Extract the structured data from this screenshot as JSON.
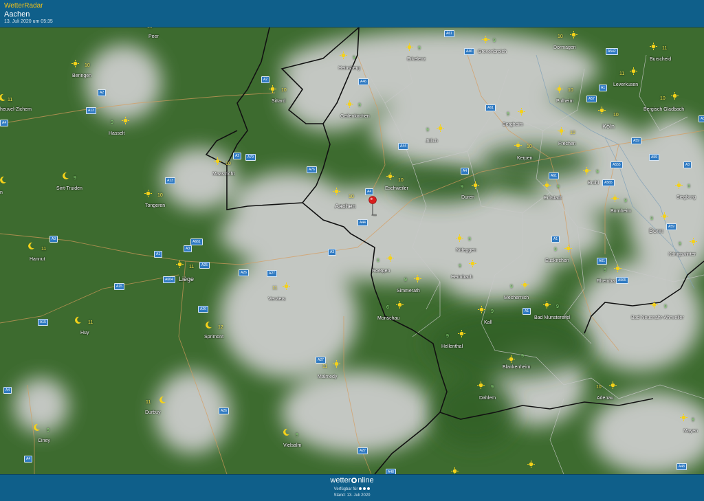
{
  "header": {
    "brand": "WetterRadar",
    "location": "Aachen",
    "timestamp": "13. Juli 2020 um 05:35"
  },
  "footer": {
    "logo_left": "wetter",
    "logo_right": "nline",
    "available": "Verfügbar für",
    "stand": "Stand: 13. Juli 2020"
  },
  "places": {
    "aachen": "Aachen",
    "eschweiler": "Eschweiler",
    "dueren": "Duren",
    "koeln": "Köln",
    "bonn": "Bonn",
    "liege": "Liège",
    "maastricht": "Maastricht",
    "sittard": "Sittard",
    "heinsberg": "Heinsberg",
    "erkelenz": "Erkelenz",
    "grevenbroich": "Grevenbroich",
    "dormagen": "Dormagen",
    "burscheid": "Burscheid",
    "leverkusen": "Leverkusen",
    "pulheim": "Pulheim",
    "bergisch_gladbach": "Bergisch Gladbach",
    "geilenkirchen": "Geilenkirchen",
    "juelich": "Jülich",
    "bergheim": "Bergheim",
    "frechen": "Frechen",
    "kerpen": "Kerpen",
    "bruehl": "Brühl",
    "erftstadt": "Erftstadt",
    "siegburg": "Siegburg",
    "bornheim": "Bornheim",
    "koenigswinter": "Königswinter",
    "nideggen": "Nideggen",
    "euskirchen": "Euskirchen",
    "roetgen": "Roetgen",
    "simmerath": "Simmerath",
    "heimbach": "Heimbach",
    "rheinbach": "Rheinbach",
    "mechernich": "Mechernich",
    "monschau": "Monschau",
    "kall": "Kall",
    "bad_muenstereifel": "Bad Munstereifel",
    "bad_neuenahr": "Bad Neuenahr-Ahrweiler",
    "hellenthal": "Hellenthal",
    "blankenheim": "Blankenheim",
    "dahlem": "Dahlem",
    "adenau": "Adenau",
    "mayen": "Mayen",
    "peer": "Peer",
    "beringen": "Beringen",
    "heusden": "heuvel-Zichem",
    "hasselt": "Hasselt",
    "sint_truiden": "Sint-Truiden",
    "tongeren": "Tongeren",
    "hannut": "Hannut",
    "huy": "Huy",
    "verviers": "Verviers",
    "spa": "Sprimont",
    "malmedy": "Malmedy",
    "durbuy": "Durbuy",
    "vielsalm": "Vielsalm",
    "ciney": "Ciney",
    "n_edge": "n"
  },
  "temps": {
    "aachen": "10",
    "eschweiler": "10",
    "dueren": "9",
    "koeln": "10",
    "bonn": "9",
    "liege": "11",
    "maastricht": "10",
    "sittard": "10",
    "heinsberg": "9",
    "erkelenz": "9",
    "grevenbroich": "9",
    "dormagen": "10",
    "burscheid": "11",
    "leverkusen": "11",
    "pulheim": "10",
    "bergisch_gladbach": "10",
    "geilenkirchen": "9",
    "juelich": "9",
    "bergheim": "9",
    "frechen": "10",
    "kerpen": "10",
    "bruehl": "9",
    "erftstadt": "9",
    "siegburg": "9",
    "bornheim": "9",
    "koenigswinter": "9",
    "nideggen": "9",
    "euskirchen": "9",
    "roetgen": "6",
    "simmerath": "9",
    "heimbach": "9",
    "rheinbach": "9",
    "mechernich": "9",
    "monschau": "6",
    "kall": "9",
    "bad_muenstereifel": "9",
    "bad_neuenahr": "9",
    "hellenthal": "9",
    "blankenheim": "9",
    "dahlem": "9",
    "adenau": "10",
    "mayen": "9",
    "peer": "10",
    "beringen": "10",
    "heusden": "11",
    "hasselt": "9",
    "sint_truiden": "9",
    "tongeren": "10",
    "hannut": "11",
    "huy": "11",
    "verviers": "11",
    "spa": "12",
    "malmedy": "11",
    "durbuy": "11",
    "vielsalm": "9",
    "ciney": "9",
    "n_edge": "11"
  },
  "roads": [
    "A61",
    "A46",
    "A542",
    "A2",
    "A46",
    "A1",
    "A57",
    "A61",
    "A3",
    "A13",
    "A2",
    "A44",
    "A59",
    "A79",
    "A2",
    "A76",
    "A4",
    "A4",
    "A555",
    "A59",
    "A3",
    "A13",
    "A4",
    "A565",
    "A61",
    "A44",
    "A1",
    "A59",
    "A3",
    "A661",
    "A3",
    "A25",
    "A27",
    "A3",
    "A1",
    "A61",
    "A604",
    "A15",
    "A565",
    "A26",
    "A15",
    "A1",
    "A27",
    "A26",
    "A4",
    "A26",
    "A27",
    "A48",
    "A4",
    "A48"
  ],
  "colors": {
    "header": "#0f5f8a",
    "brand": "#f2c318",
    "forest": "#3c6a2e",
    "cloud": "#d9d9d9"
  }
}
